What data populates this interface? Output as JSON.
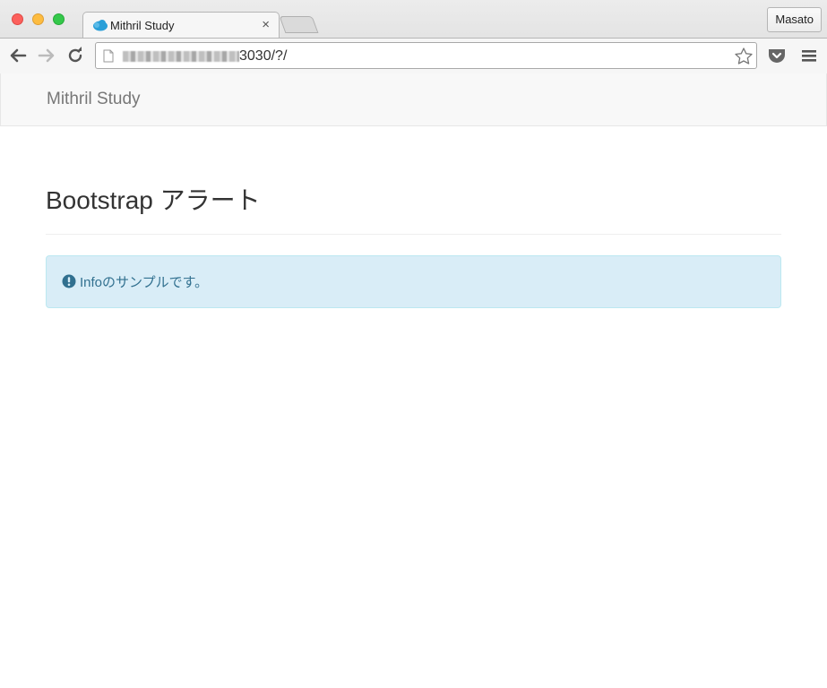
{
  "browser": {
    "tab": {
      "title": "Mithril Study",
      "favicon": "mithril-cloud-icon",
      "close_glyph": "×"
    },
    "profile_name": "Masato",
    "address_bar": {
      "url_visible": "3030/?/",
      "url_blurred": true
    },
    "toolbar_icons": [
      "back-arrow-icon",
      "forward-arrow-icon",
      "reload-icon",
      "bookmark-star-icon",
      "pocket-icon",
      "menu-icon"
    ]
  },
  "page": {
    "navbar": {
      "brand": "Mithril Study"
    },
    "header": {
      "title": "Bootstrap アラート"
    },
    "alert": {
      "type": "info",
      "icon": "exclamation-circle-icon",
      "message": "Infoのサンプルです。"
    }
  },
  "colors": {
    "alert_background": "#d9edf7",
    "alert_border": "#bce8f1",
    "alert_text": "#31708f",
    "navbar_background": "#f8f8f8",
    "brand_text": "#777777"
  }
}
